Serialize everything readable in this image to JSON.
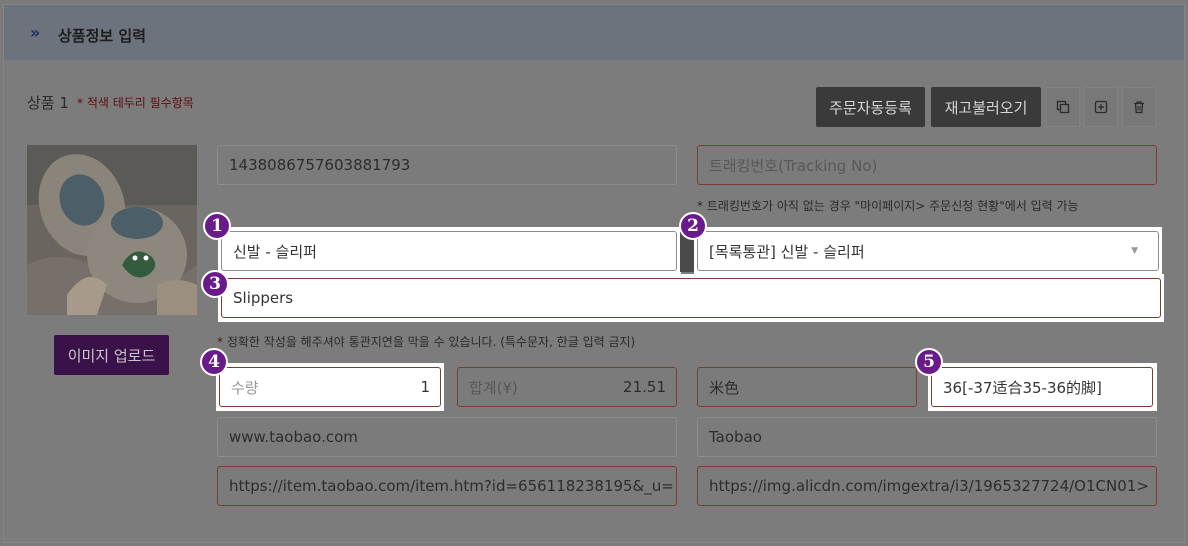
{
  "header": {
    "title": "상품정보 입력",
    "chevron": "»"
  },
  "item": {
    "title": "상품 1",
    "required_note": "* 적색 테두리 필수항목"
  },
  "toolbar": {
    "auto_order_label": "주문자동등록",
    "reload_stock_label": "재고불러오기",
    "icons": [
      "copy-icon",
      "add-icon",
      "trash-icon"
    ]
  },
  "upload": {
    "label": "이미지 업로드"
  },
  "fields": {
    "product_id": "1438086757603881793",
    "tracking_placeholder": "트래킹번호(Tracking No)",
    "tracking_note": "* 트래킹번호가 아직 없는 경우 \"마이페이지> 주문신청 현황\"에서 입력 가능",
    "category_kr": "신발 - 슬리퍼",
    "category_select": "[목록통관] 신발 - 슬리퍼",
    "name_en": "Slippers",
    "name_note_star": "*",
    "name_note": " 정확한 작성을 해주셔야 통관지연을 막을 수 있습니다. (특수문자, 한글 입력 금지)",
    "qty_label": "수량",
    "qty_value": "1",
    "total_label": "합계(¥)",
    "total_value": "21.51",
    "color": "米色",
    "size": "36[-37适合35-36的脚]",
    "site_url": "www.taobao.com",
    "site_name": "Taobao",
    "item_url": "https://item.taobao.com/item.htm?id=656118238195&_u=",
    "image_url": "https://img.alicdn.com/imgextra/i3/1965327724/O1CN01>"
  },
  "badges": [
    "1",
    "2",
    "3",
    "4",
    "5"
  ]
}
